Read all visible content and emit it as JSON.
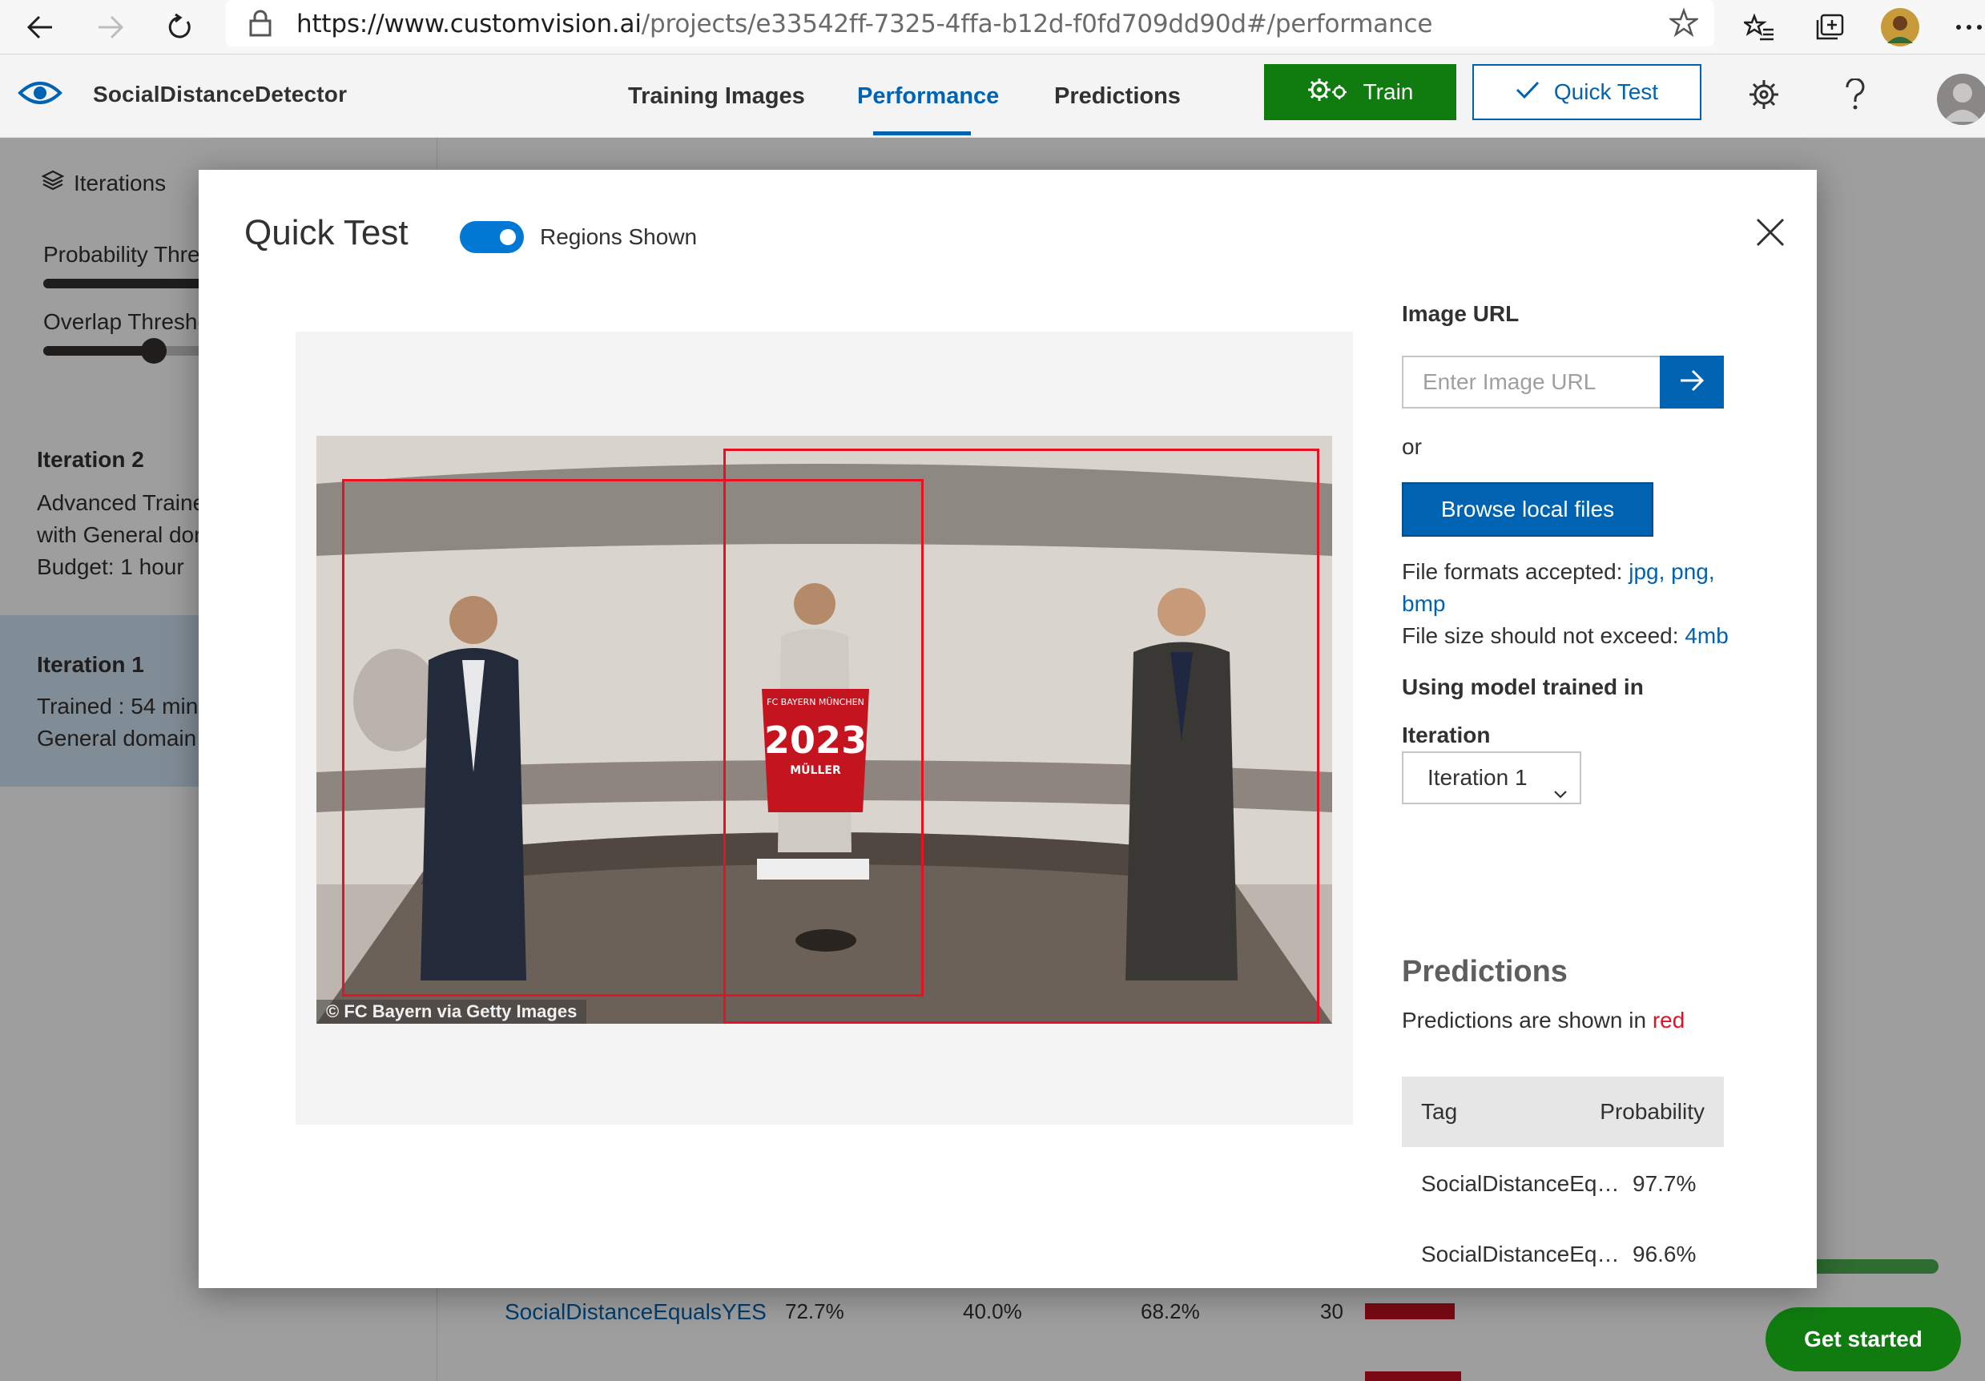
{
  "browser": {
    "url_host": "https://www.customvision.ai",
    "url_path": "/projects/e33542ff-7325-4ffa-b12d-f0fd709dd90d#/performance",
    "icons": [
      "back-arrow-icon",
      "forward-arrow-icon",
      "refresh-icon",
      "lock-icon",
      "star-icon",
      "favorites-icon",
      "collections-icon",
      "profile-avatar",
      "more-icon"
    ]
  },
  "app": {
    "name": "SocialDistanceDetector",
    "tabs": [
      {
        "label": "Training Images",
        "active": false
      },
      {
        "label": "Performance",
        "active": true
      },
      {
        "label": "Predictions",
        "active": false
      }
    ],
    "train_label": "Train",
    "quick_test_label": "Quick Test",
    "accent_color": "#0063b1",
    "train_color": "#107c10"
  },
  "sidebar": {
    "iterations_label": "Iterations",
    "probability_label": "Probability Thre",
    "overlap_label": "Overlap Thresho",
    "items": [
      {
        "title": "Iteration 2",
        "lines": [
          "Advanced Traine",
          "with General dor",
          "Budget: 1 hour"
        ],
        "selected": false
      },
      {
        "title": "Iteration 1",
        "lines": [
          "Trained : 54 minu",
          "General domain"
        ],
        "selected": true
      }
    ]
  },
  "background_table": {
    "rows": [
      {
        "tag": "SocialDistanceEqualsYES",
        "precision": "72.7%",
        "recall": "40.0%",
        "ap": "68.2%",
        "count": "30"
      },
      {
        "tag": "",
        "precision": "",
        "recall": "",
        "ap": "",
        "count": ""
      }
    ]
  },
  "get_started_label": "Get started",
  "modal": {
    "title": "Quick Test",
    "toggle_label": "Regions Shown",
    "toggle_on": true,
    "photo_credit": "© FC Bayern via Getty Images",
    "jersey_number": "2023",
    "jersey_name": "MÜLLER",
    "jersey_club": "FC BAYERN MÜNCHEN",
    "image_url_label": "Image URL",
    "image_url_placeholder": "Enter Image URL",
    "or_label": "or",
    "browse_label": "Browse local files",
    "formats_prefix": "File formats accepted: ",
    "formats_line1": "jpg, png,",
    "formats_line2": "bmp",
    "size_prefix": "File size should not exceed: ",
    "size_value": "4mb",
    "model_label": "Using model trained in",
    "iteration_label": "Iteration",
    "iteration_value": "Iteration 1",
    "predictions_title": "Predictions",
    "predictions_note_prefix": "Predictions are shown in ",
    "predictions_note_color": "red",
    "table_headers": {
      "tag": "Tag",
      "probability": "Probability"
    },
    "predictions": [
      {
        "tag": "SocialDistanceEqua...",
        "probability": "97.7%"
      },
      {
        "tag": "SocialDistanceEqua...",
        "probability": "96.6%"
      }
    ]
  }
}
